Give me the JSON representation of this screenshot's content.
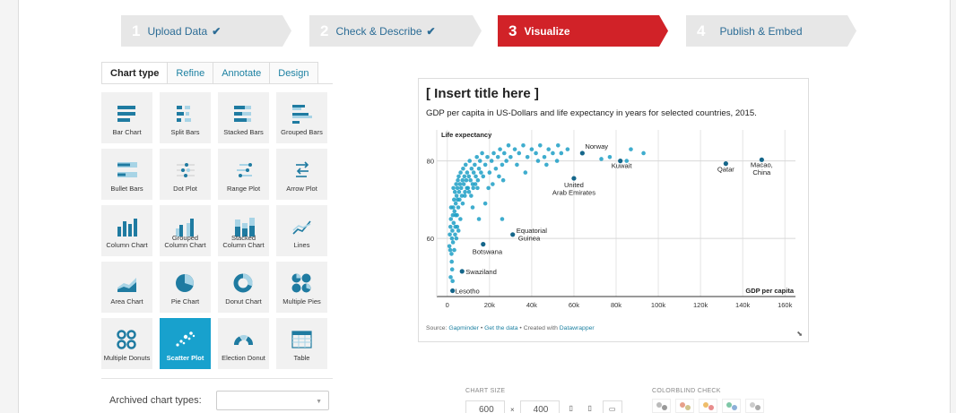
{
  "steps": [
    {
      "num": "1",
      "label": "Upload Data",
      "check": "✔"
    },
    {
      "num": "2",
      "label": "Check & Describe",
      "check": "✔"
    },
    {
      "num": "3",
      "label": "Visualize",
      "check": ""
    },
    {
      "num": "4",
      "label": "Publish & Embed",
      "check": ""
    }
  ],
  "tabs": [
    "Chart type",
    "Refine",
    "Annotate",
    "Design"
  ],
  "chart_types": [
    {
      "label": "Bar Chart",
      "icon": "bar-chart-icon"
    },
    {
      "label": "Split Bars",
      "icon": "split-bars-icon"
    },
    {
      "label": "Stacked Bars",
      "icon": "stacked-bars-icon"
    },
    {
      "label": "Grouped Bars",
      "icon": "grouped-bars-icon"
    },
    {
      "label": "Bullet Bars",
      "icon": "bullet-bars-icon"
    },
    {
      "label": "Dot Plot",
      "icon": "dot-plot-icon"
    },
    {
      "label": "Range Plot",
      "icon": "range-plot-icon"
    },
    {
      "label": "Arrow Plot",
      "icon": "arrow-plot-icon"
    },
    {
      "label": "Column Chart",
      "icon": "column-chart-icon"
    },
    {
      "label": "Grouped Column Chart",
      "icon": "grouped-column-chart-icon"
    },
    {
      "label": "Stacked Column Chart",
      "icon": "stacked-column-chart-icon"
    },
    {
      "label": "Lines",
      "icon": "lines-icon"
    },
    {
      "label": "Area Chart",
      "icon": "area-chart-icon"
    },
    {
      "label": "Pie Chart",
      "icon": "pie-chart-icon"
    },
    {
      "label": "Donut Chart",
      "icon": "donut-chart-icon"
    },
    {
      "label": "Multiple Pies",
      "icon": "multiple-pies-icon"
    },
    {
      "label": "Multiple Donuts",
      "icon": "multiple-donuts-icon"
    },
    {
      "label": "Scatter Plot",
      "icon": "scatter-plot-icon",
      "selected": true
    },
    {
      "label": "Election Donut",
      "icon": "election-donut-icon"
    },
    {
      "label": "Table",
      "icon": "table-icon"
    }
  ],
  "archived": {
    "label": "Archived chart types:",
    "value": ""
  },
  "preview": {
    "title": "[ Insert title here ]",
    "description": "GDP per capita in US-Dollars and life expectancy in years for selected countries, 2015.",
    "source_prefix": "Source: ",
    "source_link": "Gapminder",
    "get_data": "Get the data",
    "created_with": "Created with ",
    "created_link": "Datawrapper",
    "bullet": " • "
  },
  "chart_data": {
    "type": "scatter",
    "title": "[ Insert title here ]",
    "subtitle": "GDP per capita in US-Dollars and life expectancy in years for selected countries, 2015.",
    "xlabel": "GDP per capita",
    "ylabel": "Life expectancy",
    "xlim": [
      -5000,
      165000
    ],
    "ylim": [
      45,
      88
    ],
    "xticks": [
      0,
      20000,
      40000,
      60000,
      80000,
      100000,
      120000,
      140000,
      160000
    ],
    "xtick_labels": [
      "0",
      "20k",
      "40k",
      "60k",
      "80k",
      "100k",
      "120k",
      "140k",
      "160k"
    ],
    "yticks": [
      60,
      80
    ],
    "grid": true,
    "color": "#1d9fc6",
    "label_color": "#15668a",
    "labeled_points": [
      {
        "name": "Norway",
        "x": 64000,
        "y": 82
      },
      {
        "name": "Kuwait",
        "x": 82000,
        "y": 80
      },
      {
        "name": "United Arab Emirates",
        "x": 60000,
        "y": 75.5
      },
      {
        "name": "Qatar",
        "x": 132000,
        "y": 79.3
      },
      {
        "name": "Macao, China",
        "x": 149000,
        "y": 80.3
      },
      {
        "name": "Equatorial Guinea",
        "x": 31000,
        "y": 61
      },
      {
        "name": "Botswana",
        "x": 17000,
        "y": 58.5
      },
      {
        "name": "Swaziland",
        "x": 7000,
        "y": 51.5
      },
      {
        "name": "Lesotho",
        "x": 2500,
        "y": 46.5
      }
    ],
    "points": [
      [
        1000,
        58
      ],
      [
        1200,
        61
      ],
      [
        1500,
        63
      ],
      [
        1700,
        65
      ],
      [
        2000,
        56
      ],
      [
        2200,
        60
      ],
      [
        2400,
        62
      ],
      [
        2600,
        66
      ],
      [
        2800,
        68
      ],
      [
        3000,
        64
      ],
      [
        3200,
        70
      ],
      [
        3400,
        67
      ],
      [
        3600,
        72
      ],
      [
        3800,
        63
      ],
      [
        4000,
        69
      ],
      [
        4200,
        74
      ],
      [
        4400,
        71
      ],
      [
        4600,
        66
      ],
      [
        4800,
        73
      ],
      [
        5000,
        75
      ],
      [
        5200,
        68
      ],
      [
        5400,
        76
      ],
      [
        5600,
        72
      ],
      [
        5800,
        70
      ],
      [
        6000,
        74
      ],
      [
        6300,
        77
      ],
      [
        6600,
        73
      ],
      [
        6900,
        71
      ],
      [
        7200,
        75
      ],
      [
        7500,
        78
      ],
      [
        7800,
        74
      ],
      [
        8100,
        76
      ],
      [
        8400,
        72
      ],
      [
        8700,
        79
      ],
      [
        9000,
        75
      ],
      [
        9400,
        77
      ],
      [
        9800,
        73
      ],
      [
        10200,
        76
      ],
      [
        10600,
        80
      ],
      [
        11000,
        75
      ],
      [
        11500,
        78
      ],
      [
        12000,
        74
      ],
      [
        12500,
        77
      ],
      [
        13000,
        79
      ],
      [
        13500,
        76
      ],
      [
        14000,
        81
      ],
      [
        14500,
        75
      ],
      [
        15000,
        78
      ],
      [
        15500,
        80
      ],
      [
        16000,
        77
      ],
      [
        16500,
        82
      ],
      [
        17000,
        76
      ],
      [
        18000,
        79
      ],
      [
        19000,
        81
      ],
      [
        20000,
        77
      ],
      [
        21000,
        80
      ],
      [
        22000,
        82
      ],
      [
        23000,
        78
      ],
      [
        24000,
        81
      ],
      [
        25000,
        83
      ],
      [
        26000,
        79
      ],
      [
        27000,
        82
      ],
      [
        28000,
        80
      ],
      [
        29000,
        84
      ],
      [
        30000,
        81
      ],
      [
        32000,
        83
      ],
      [
        34000,
        82
      ],
      [
        36000,
        84
      ],
      [
        38000,
        81
      ],
      [
        40000,
        83
      ],
      [
        42000,
        82
      ],
      [
        44000,
        84
      ],
      [
        46000,
        81
      ],
      [
        48000,
        83
      ],
      [
        50000,
        82
      ],
      [
        52000,
        80
      ],
      [
        54000,
        82
      ],
      [
        57000,
        83
      ],
      [
        2300,
        52
      ],
      [
        3300,
        57
      ],
      [
        4300,
        60
      ],
      [
        5300,
        62
      ],
      [
        1800,
        68
      ],
      [
        2900,
        73
      ],
      [
        3900,
        66
      ],
      [
        4900,
        70
      ],
      [
        6200,
        65
      ],
      [
        7300,
        69
      ],
      [
        8300,
        71
      ],
      [
        9300,
        73
      ],
      [
        10300,
        72
      ],
      [
        11300,
        71
      ],
      [
        12300,
        73
      ],
      [
        13300,
        74
      ],
      [
        14300,
        73
      ],
      [
        2100,
        54
      ],
      [
        1400,
        57
      ],
      [
        2700,
        59
      ],
      [
        3700,
        61
      ],
      [
        4700,
        63
      ],
      [
        21500,
        74
      ],
      [
        19500,
        73
      ],
      [
        24500,
        76
      ],
      [
        26500,
        75
      ],
      [
        33000,
        79
      ],
      [
        37000,
        77
      ],
      [
        43000,
        80
      ],
      [
        47000,
        79
      ],
      [
        52500,
        84
      ],
      [
        73000,
        80.5
      ],
      [
        77000,
        81
      ],
      [
        85000,
        80
      ],
      [
        87000,
        83
      ],
      [
        93000,
        82
      ],
      [
        1600,
        50
      ],
      [
        2500,
        49
      ],
      [
        26000,
        65
      ],
      [
        18000,
        69
      ],
      [
        15000,
        65
      ],
      [
        12000,
        68
      ]
    ]
  },
  "size": {
    "label": "CHART SIZE",
    "width": "600",
    "height": "400",
    "x": "×"
  },
  "colorblind": {
    "label": "COLORBLIND CHECK"
  }
}
